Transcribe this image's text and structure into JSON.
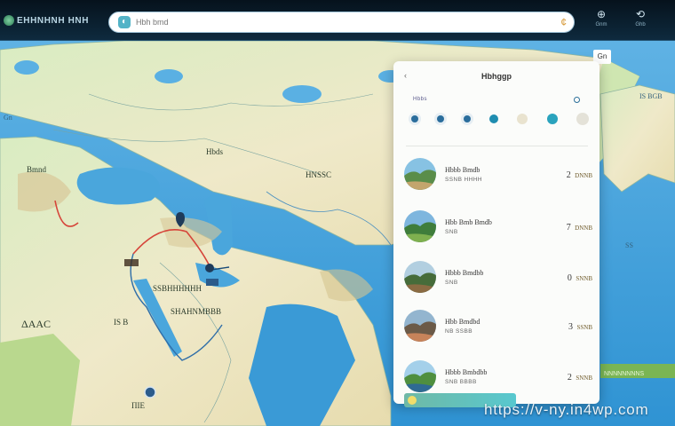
{
  "header": {
    "logo_text": "EHHNHNH HNH",
    "search_placeholder": "Hbh bmd",
    "close_glyph": "¢",
    "btn1_glyph": "⊕",
    "btn1_label": "Gnm",
    "btn2_glyph": "⟲",
    "btn2_label": "Ghb"
  },
  "map": {
    "labels": [
      {
        "text": "Hbds"
      },
      {
        "text": "Bmnd"
      },
      {
        "text": "HNSSC"
      },
      {
        "text": "ΔΑAC"
      },
      {
        "text": "SSBHHHHHH"
      },
      {
        "text": "SHAHNMBBB"
      },
      {
        "text": "IS B"
      },
      {
        "text": "ΠΙΕ"
      }
    ],
    "sea_labels": [
      {
        "text": "Gn"
      },
      {
        "text": "IS BGB"
      },
      {
        "text": "SS"
      }
    ],
    "corner_badge": "Gn",
    "green_strip_text": "NNNNNNNNS",
    "colors": {
      "water": "#3f9fd8",
      "land": "#efe9c9",
      "route": "#d6453a",
      "route2": "#2f6ea8"
    }
  },
  "panel": {
    "title": "Hbhggp",
    "back_glyph": "‹",
    "sub": "Hbbs",
    "dot_colors": [
      "#2a6d9c",
      "#2a6d9c",
      "#2a6d9c",
      "#1f8db0",
      "#e9e3cf",
      "#2aa3bd",
      "#e4e2d8"
    ],
    "cards": [
      {
        "title": "Hbbb Bmdb",
        "sub": "SSNB  HHHH",
        "num": "2",
        "badge": "DNNB"
      },
      {
        "title": "Hbb  Bmb Bmdb",
        "sub": "SNB",
        "num": "7",
        "badge": "DNNB"
      },
      {
        "title": "Hbbb Bmdbb",
        "sub": "SNB",
        "num": "0",
        "badge": "SNNB"
      },
      {
        "title": "Hbb Bmdbd",
        "sub": "NB    SSBB",
        "num": "3",
        "badge": "SSNB"
      },
      {
        "title": "Hbbb Bmbdbb",
        "sub": "SNB   BBBB",
        "num": "2",
        "badge": "SNNB"
      }
    ]
  },
  "watermark": "https://v-ny.in4wp.com"
}
